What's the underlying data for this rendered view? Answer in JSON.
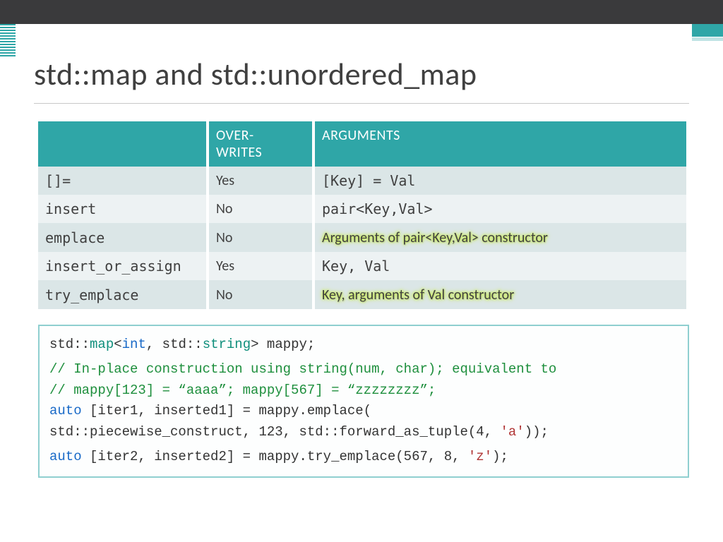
{
  "title": "std::map and std::unordered_map",
  "table": {
    "headers": {
      "method": "",
      "overwrites_line1": "Over-",
      "overwrites_line2": "writes",
      "arguments": "Arguments"
    },
    "rows": [
      {
        "method": "[]=",
        "over": "Yes",
        "args_plain": "[Key] = Val",
        "highlight": false
      },
      {
        "method": "insert",
        "over": "No",
        "args_plain": "pair<Key,Val>",
        "highlight": false
      },
      {
        "method": "emplace",
        "over": "No",
        "args_plain": "Arguments of pair<Key,Val> constructor",
        "highlight": true
      },
      {
        "method": "insert_or_assign",
        "over": "Yes",
        "args_plain": "Key, Val",
        "highlight": false
      },
      {
        "method": "try_emplace",
        "over": "No",
        "args_plain": "Key, arguments of Val constructor",
        "highlight": true
      }
    ]
  },
  "code": {
    "l1a": "std::",
    "l1b": "map",
    "l1c": "<",
    "l1d": "int",
    "l1e": ", std::",
    "l1f": "string",
    "l1g": "> mappy;",
    "l2": "// In-place construction using string(num, char); equivalent to",
    "l3": "//    mappy[123] = “aaaa”; mappy[567] = “zzzzzzzz”;",
    "l4a": "auto",
    "l4b": " [iter1, inserted1] = mappy.emplace(",
    "l5a": "    std::piecewise_construct, 123, std::forward_as_tuple(4, ",
    "l5b": "'a'",
    "l5c": "));",
    "l6a": "auto",
    "l6b": " [iter2, inserted2] = mappy.try_emplace(567, 8, ",
    "l6c": "'z'",
    "l6d": ");"
  }
}
